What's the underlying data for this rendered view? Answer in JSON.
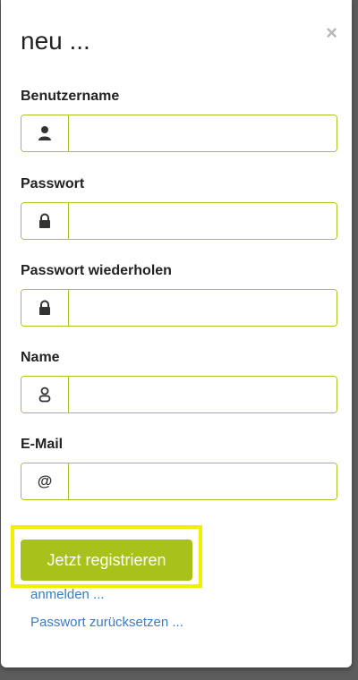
{
  "dialog": {
    "title": "neu ...",
    "close_symbol": "×"
  },
  "fields": [
    {
      "label": "Benutzername",
      "value": "",
      "icon": "user-icon"
    },
    {
      "label": "Passwort",
      "value": "",
      "icon": "lock-icon"
    },
    {
      "label": "Passwort wiederholen",
      "value": "",
      "icon": "lock-icon"
    },
    {
      "label": "Name",
      "value": "",
      "icon": "person-outline-icon"
    },
    {
      "label": "E-Mail",
      "value": "",
      "icon": "at-icon",
      "icon_glyph": "@"
    }
  ],
  "actions": {
    "register_label": "Jetzt registrieren",
    "login_link": "anmelden ...",
    "reset_link": "Passwort zurücksetzen ..."
  },
  "colors": {
    "accent": "#a9c21b",
    "input_border": "#a9c523",
    "highlight": "#f4ef00",
    "link": "#3a7cc0",
    "backdrop": "#5c5c5c"
  }
}
